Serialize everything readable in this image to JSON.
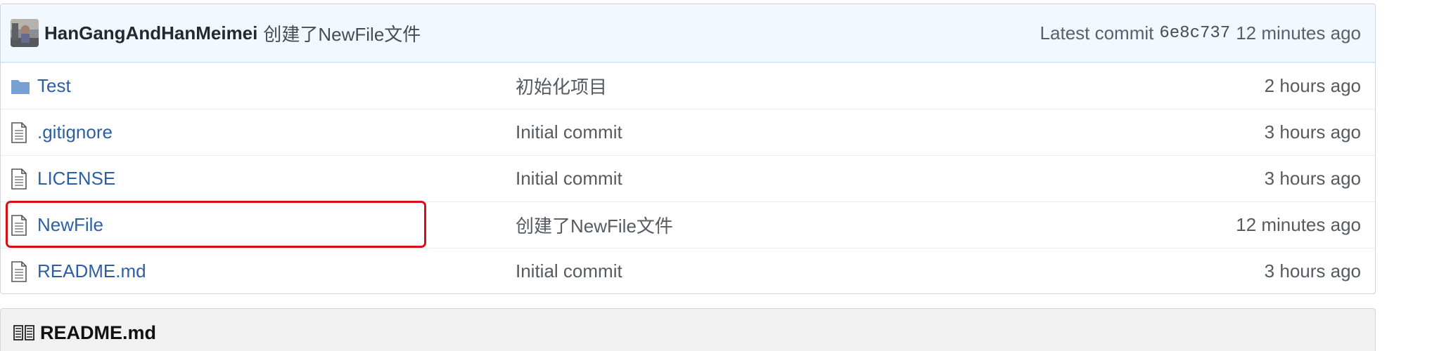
{
  "commit": {
    "author": "HanGangAndHanMeimei",
    "message": "创建了NewFile文件",
    "latest_label": "Latest commit",
    "sha": "6e8c737",
    "age": "12 minutes ago"
  },
  "files": [
    {
      "name": "Test",
      "type": "folder",
      "message": "初始化项目",
      "age": "2 hours ago"
    },
    {
      "name": ".gitignore",
      "type": "file",
      "message": "Initial commit",
      "age": "3 hours ago"
    },
    {
      "name": "LICENSE",
      "type": "file",
      "message": "Initial commit",
      "age": "3 hours ago"
    },
    {
      "name": "NewFile",
      "type": "file",
      "message": "创建了NewFile文件",
      "age": "12 minutes ago"
    },
    {
      "name": "README.md",
      "type": "file",
      "message": "Initial commit",
      "age": "3 hours ago"
    }
  ],
  "readme": {
    "title": "README.md",
    "icon": "book-icon"
  },
  "colors": {
    "link": "#2d5fa6",
    "highlight": "#d90f17",
    "folder": "#78a0d3"
  },
  "icons": {
    "folder": "folder-icon",
    "file": "file-text-icon",
    "avatar": "avatar"
  }
}
